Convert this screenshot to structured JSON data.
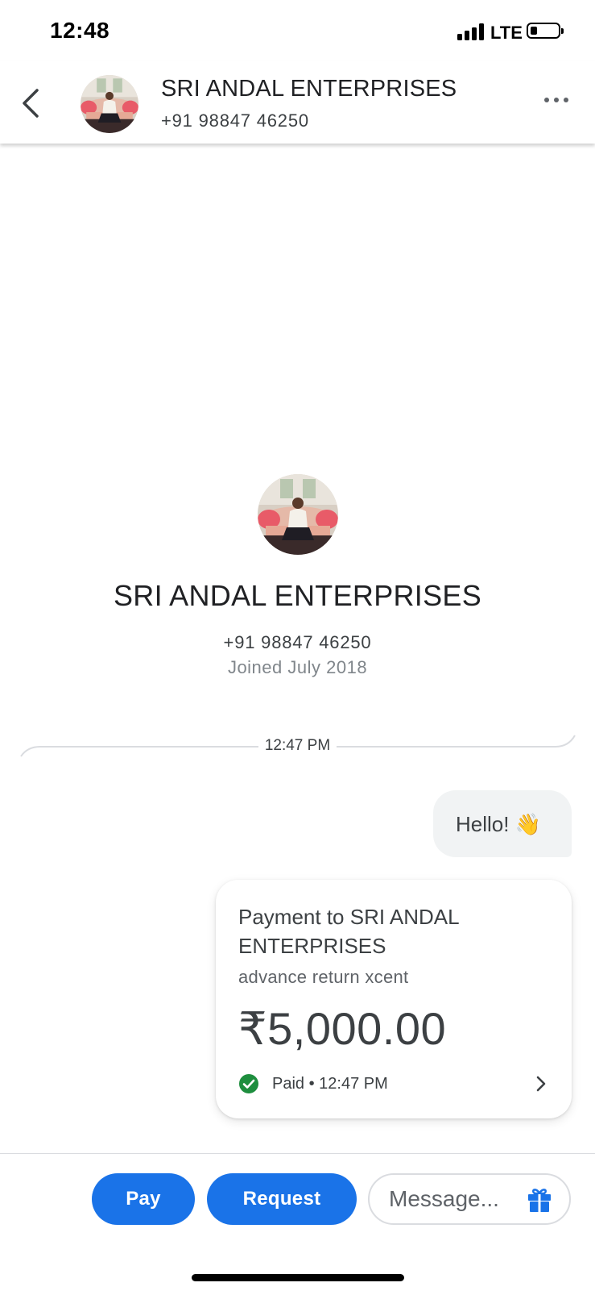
{
  "status_bar": {
    "time": "12:48",
    "network": "LTE"
  },
  "header": {
    "name": "SRI ANDAL ENTERPRISES",
    "phone": "+91 98847 46250",
    "icons": {
      "back": "chevron-left-icon",
      "more": "more-horizontal-icon"
    }
  },
  "profile": {
    "name": "SRI ANDAL ENTERPRISES",
    "phone": "+91 98847 46250",
    "joined": "Joined July 2018"
  },
  "conversation": {
    "divider_time": "12:47 PM",
    "messages": [
      {
        "type": "text",
        "text": "Hello! 👋"
      }
    ],
    "payment": {
      "title": "Payment to SRI ANDAL ENTERPRISES",
      "note": "advance return xcent",
      "amount": "₹5,000.00",
      "status": "Paid • 12:47 PM",
      "status_color": "#1e8e3e"
    }
  },
  "bottom_bar": {
    "pay_label": "Pay",
    "request_label": "Request",
    "message_placeholder": "Message...",
    "accent": "#1a73e8"
  }
}
